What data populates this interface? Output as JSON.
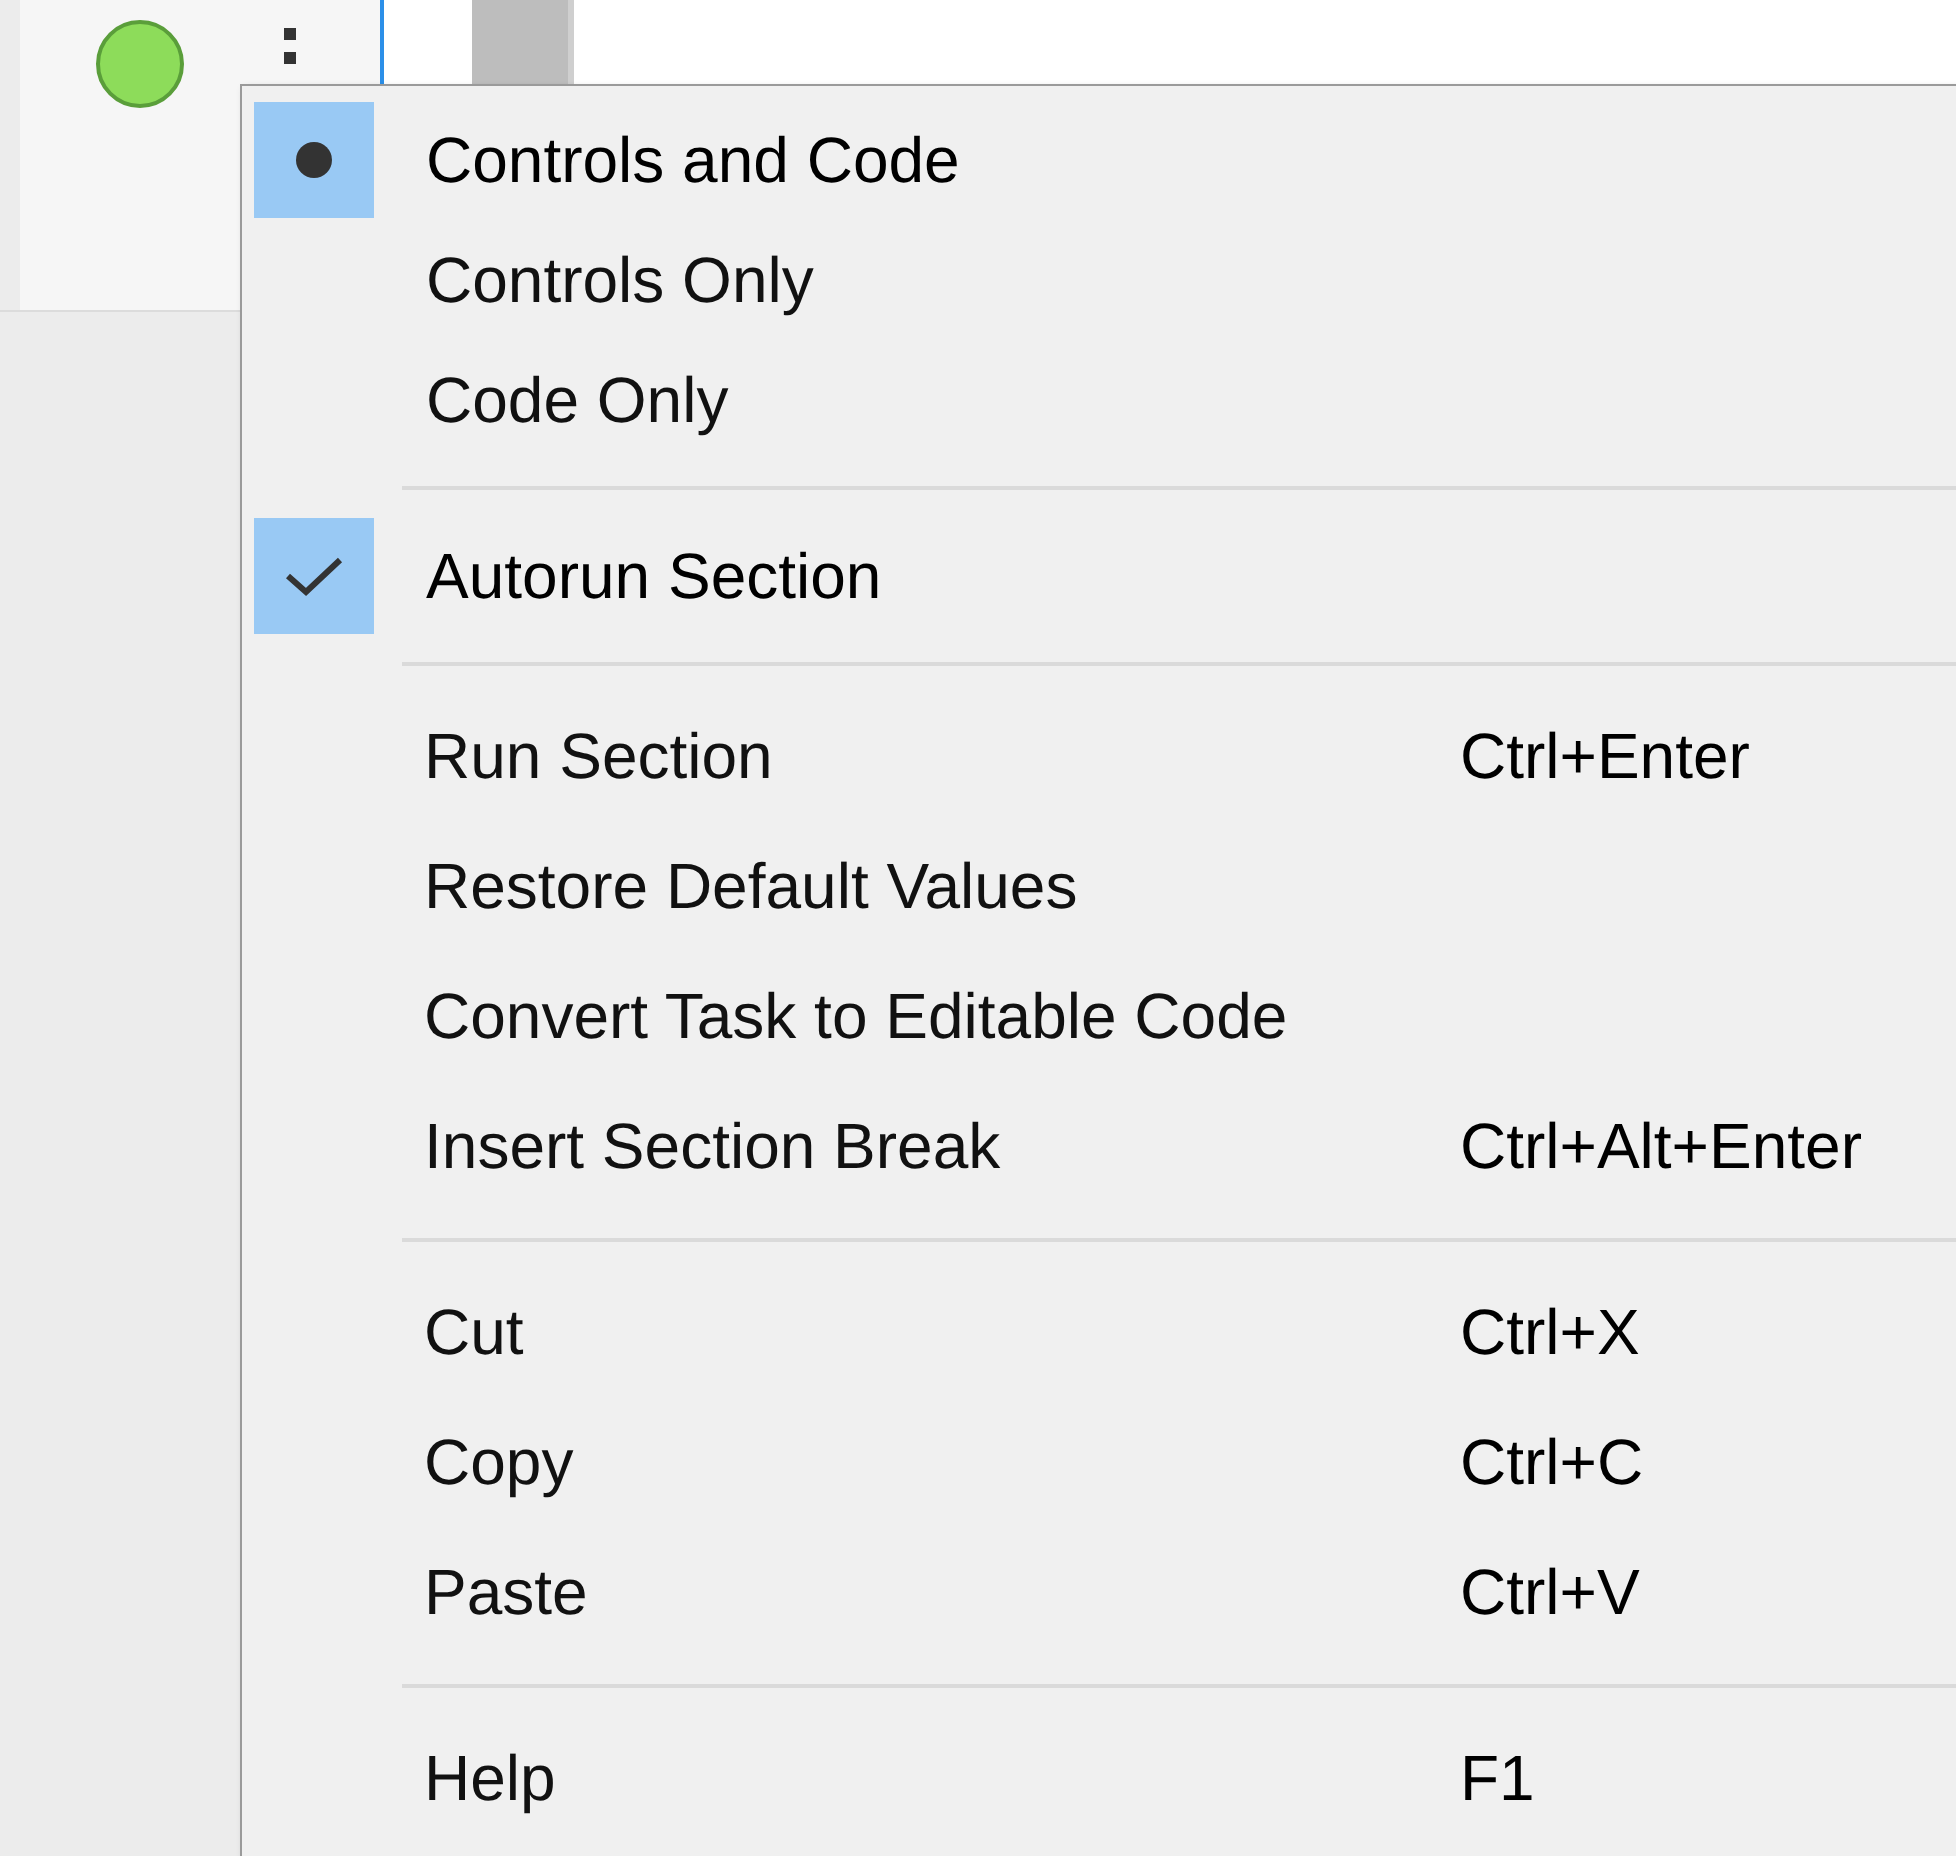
{
  "status_indicator": {
    "color": "#8ddc5a"
  },
  "context_menu": {
    "groups": [
      {
        "items": [
          {
            "kind": "radio",
            "label": "Controls and Code",
            "selected": true
          },
          {
            "kind": "radio",
            "label": "Controls Only",
            "selected": false
          },
          {
            "kind": "radio",
            "label": "Code Only",
            "selected": false
          }
        ]
      },
      {
        "items": [
          {
            "kind": "check",
            "label": "Autorun Section",
            "checked": true
          }
        ]
      },
      {
        "items": [
          {
            "kind": "command",
            "label": "Run Section",
            "shortcut": "Ctrl+Enter"
          },
          {
            "kind": "command",
            "label": "Restore Default Values"
          },
          {
            "kind": "command",
            "label": "Convert Task to Editable Code"
          },
          {
            "kind": "command",
            "label": "Insert Section Break",
            "shortcut": "Ctrl+Alt+Enter"
          }
        ]
      },
      {
        "items": [
          {
            "kind": "command",
            "label": "Cut",
            "shortcut": "Ctrl+X"
          },
          {
            "kind": "command",
            "label": "Copy",
            "shortcut": "Ctrl+C"
          },
          {
            "kind": "command",
            "label": "Paste",
            "shortcut": "Ctrl+V"
          }
        ]
      },
      {
        "items": [
          {
            "kind": "command",
            "label": "Help",
            "shortcut": "F1"
          }
        ]
      }
    ]
  }
}
